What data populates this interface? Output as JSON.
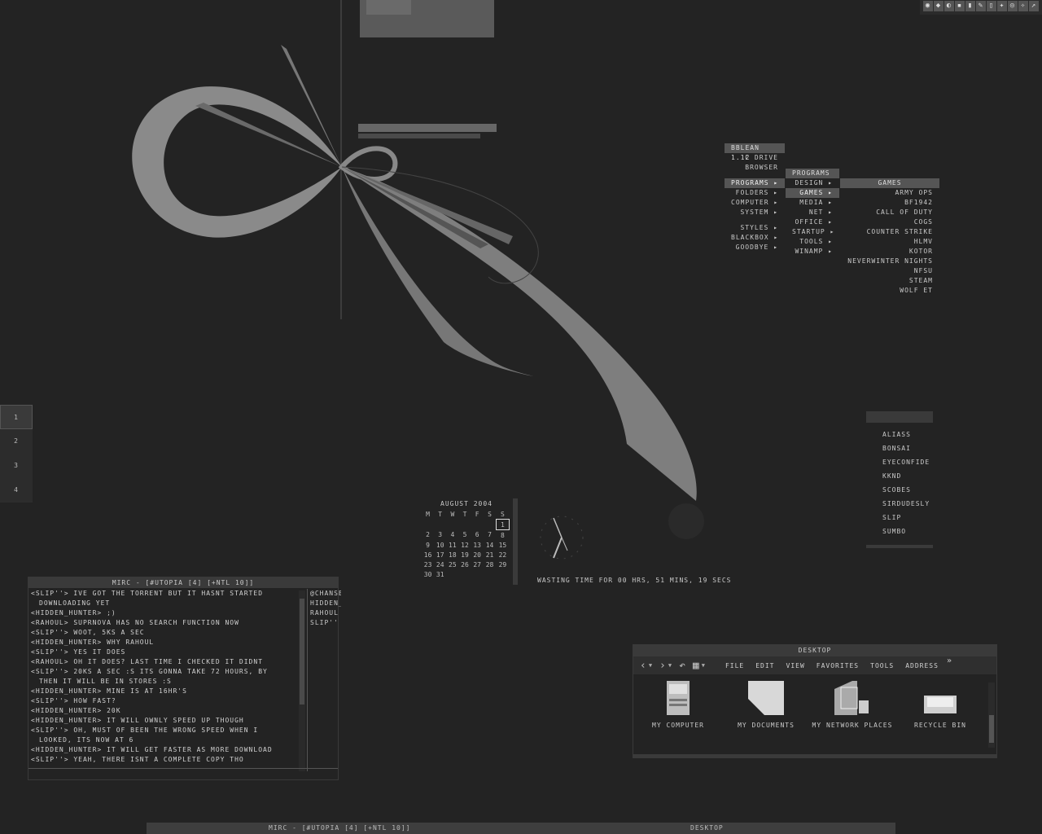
{
  "tray": {
    "icons": [
      "app-icon",
      "app-icon",
      "app-icon",
      "app-icon",
      "app-icon",
      "app-icon",
      "app-icon",
      "app-icon",
      "app-icon",
      "app-icon",
      "app-icon"
    ]
  },
  "root_menu": {
    "header": "BBLEAN 1.12",
    "items": [
      "C DRIVE",
      "BROWSER",
      "PROGRAMS ▸",
      "FOLDERS ▸",
      "COMPUTER ▸",
      "SYSTEM ▸",
      "STYLES ▸",
      "BLACKBOX ▸",
      "GOODBYE ▸"
    ]
  },
  "programs_menu": {
    "header": "PROGRAMS",
    "items": [
      "DESIGN ▸",
      "GAMES ▸",
      "MEDIA ▸",
      "NET ▸",
      "OFFICE ▸",
      "STARTUP ▸",
      "TOOLS ▸",
      "WINAMP ▸"
    ]
  },
  "games_menu": {
    "header": "GAMES",
    "items": [
      "ARMY OPS",
      "BF1942",
      "CALL OF DUTY",
      "COGS",
      "COUNTER STRIKE",
      "HLMV",
      "KOTOR",
      "NEVERWINTER NIGHTS",
      "NFSU",
      "STEAM",
      "WOLF ET"
    ]
  },
  "pager": {
    "workspaces": [
      "1",
      "2",
      "3",
      "4"
    ]
  },
  "buddies": {
    "items": [
      "ALIASS",
      "BONSAI",
      "EYECONFIDE",
      "KKND",
      "SCOBES",
      "SIRDUDESLY",
      "SLIP",
      "SUMBO"
    ]
  },
  "calendar": {
    "title": "AUGUST 2004",
    "weekdays": [
      "M",
      "T",
      "W",
      "T",
      "F",
      "S",
      "S"
    ],
    "weeks": [
      [
        "",
        "",
        "",
        "",
        "",
        "",
        "1"
      ],
      [
        "2",
        "3",
        "4",
        "5",
        "6",
        "7",
        "8"
      ],
      [
        "9",
        "10",
        "11",
        "12",
        "13",
        "14",
        "15"
      ],
      [
        "16",
        "17",
        "18",
        "19",
        "20",
        "21",
        "22"
      ],
      [
        "23",
        "24",
        "25",
        "26",
        "27",
        "28",
        "29"
      ],
      [
        "30",
        "31",
        "",
        "",
        "",
        "",
        ""
      ]
    ],
    "today": "1"
  },
  "uptime": {
    "text": "WASTING TIME FOR 00 HRS, 51 MINS, 19 SECS"
  },
  "mirc": {
    "title": "MIRC - [#UTOPIA [4] [+NTL 10]]",
    "lines": [
      {
        "text": "<SLIP''> IVE GOT THE TORRENT BUT IT HASNT STARTED",
        "cont": false
      },
      {
        "text": "DOWNLOADING YET",
        "cont": true
      },
      {
        "text": "<HIDDEN_HUNTER> ;)",
        "cont": false
      },
      {
        "text": "<RAHOUL> SUPRNOVA HAS NO SEARCH FUNCTION NOW",
        "cont": false
      },
      {
        "text": "<SLIP''> WOOT, 5KS A SEC",
        "cont": false
      },
      {
        "text": "<HIDDEN_HUNTER> WHY RAHOUL",
        "cont": false
      },
      {
        "text": "<SLIP''> YES IT DOES",
        "cont": false
      },
      {
        "text": "<RAHOUL> OH IT DOES? LAST TIME I CHECKED IT DIDNT",
        "cont": false
      },
      {
        "text": "<SLIP''> 20KS A SEC :S ITS GONNA TAKE 72 HOURS, BY",
        "cont": false
      },
      {
        "text": "THEN IT WILL BE IN STORES :S",
        "cont": true
      },
      {
        "text": "<HIDDEN_HUNTER> MINE IS AT 16HR'S",
        "cont": false
      },
      {
        "text": "<SLIP''> HOW FAST?",
        "cont": false
      },
      {
        "text": "<HIDDEN_HUNTER> 20K",
        "cont": false
      },
      {
        "text": "<HIDDEN_HUNTER> IT WILL OWNLY SPEED UP THOUGH",
        "cont": false
      },
      {
        "text": "<SLIP''> OH, MUST OF BEEN THE WRONG SPEED WHEN I",
        "cont": false
      },
      {
        "text": "LOOKED, ITS NOW AT 6",
        "cont": true
      },
      {
        "text": "<HIDDEN_HUNTER> IT WILL GET FASTER AS MORE DOWNLOAD",
        "cont": false
      },
      {
        "text": "<SLIP''> YEAH, THERE ISNT A COMPLETE COPY THO",
        "cont": false
      }
    ],
    "nicks": [
      "@CHANSERV",
      "HIDDEN_HUNTER",
      "RAHOUL",
      "SLIP''"
    ]
  },
  "explorer": {
    "title": "DESKTOP",
    "menu": [
      "FILE",
      "EDIT",
      "VIEW",
      "FAVORITES",
      "TOOLS"
    ],
    "more": "»",
    "address_label": "ADDRESS",
    "icons": [
      {
        "label": "MY COMPUTER",
        "icon": "computer-icon"
      },
      {
        "label": "MY DOCUMENTS",
        "icon": "documents-icon"
      },
      {
        "label": "MY NETWORK PLACES",
        "icon": "network-icon"
      },
      {
        "label": "RECYCLE BIN",
        "icon": "recycle-bin-icon"
      }
    ]
  },
  "taskbar": {
    "tasks": [
      "MIRC - [#UTOPIA [4] [+NTL 10]]",
      "DESKTOP"
    ]
  },
  "colors": {
    "background": "#232323",
    "panel": "#3a3a3a",
    "highlight": "#555555",
    "text": "#c8c8c8"
  }
}
